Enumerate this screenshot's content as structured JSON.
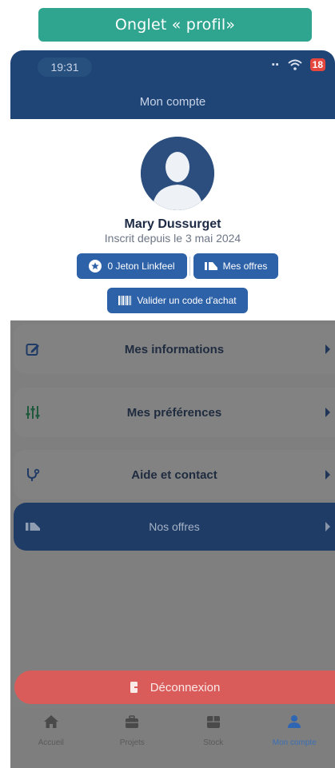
{
  "caption": "Onglet « profil»",
  "status_bar": {
    "time": "19:31",
    "battery": "18"
  },
  "header": {
    "title": "Mon compte"
  },
  "profile": {
    "name": "Mary Dussurget",
    "member_since": "Inscrit depuis le 3 mai 2024",
    "token_button": "0 Jeton Linkfeel",
    "offers_button": "Mes offres",
    "code_button": "Valider un code d'achat"
  },
  "menu": {
    "items": [
      {
        "label": "Mes informations",
        "icon": "edit-icon"
      },
      {
        "label": "Mes préférences",
        "icon": "sliders-icon"
      },
      {
        "label": "Aide et contact",
        "icon": "stethoscope-icon"
      },
      {
        "label": "Nos offres",
        "icon": "ticket-icon"
      }
    ]
  },
  "logout": {
    "label": "Déconnexion"
  },
  "tabbar": {
    "tabs": [
      {
        "label": "Accueil",
        "icon": "home-icon"
      },
      {
        "label": "Projets",
        "icon": "briefcase-icon"
      },
      {
        "label": "Stock",
        "icon": "stock-icon"
      },
      {
        "label": "Mon compte",
        "icon": "user-icon",
        "active": true
      }
    ]
  },
  "colors": {
    "header": "#1f4476",
    "button": "#2d61a8",
    "caption": "#2fa58f",
    "logout": "#d95c5b",
    "active_tab": "#3b6fb5"
  }
}
